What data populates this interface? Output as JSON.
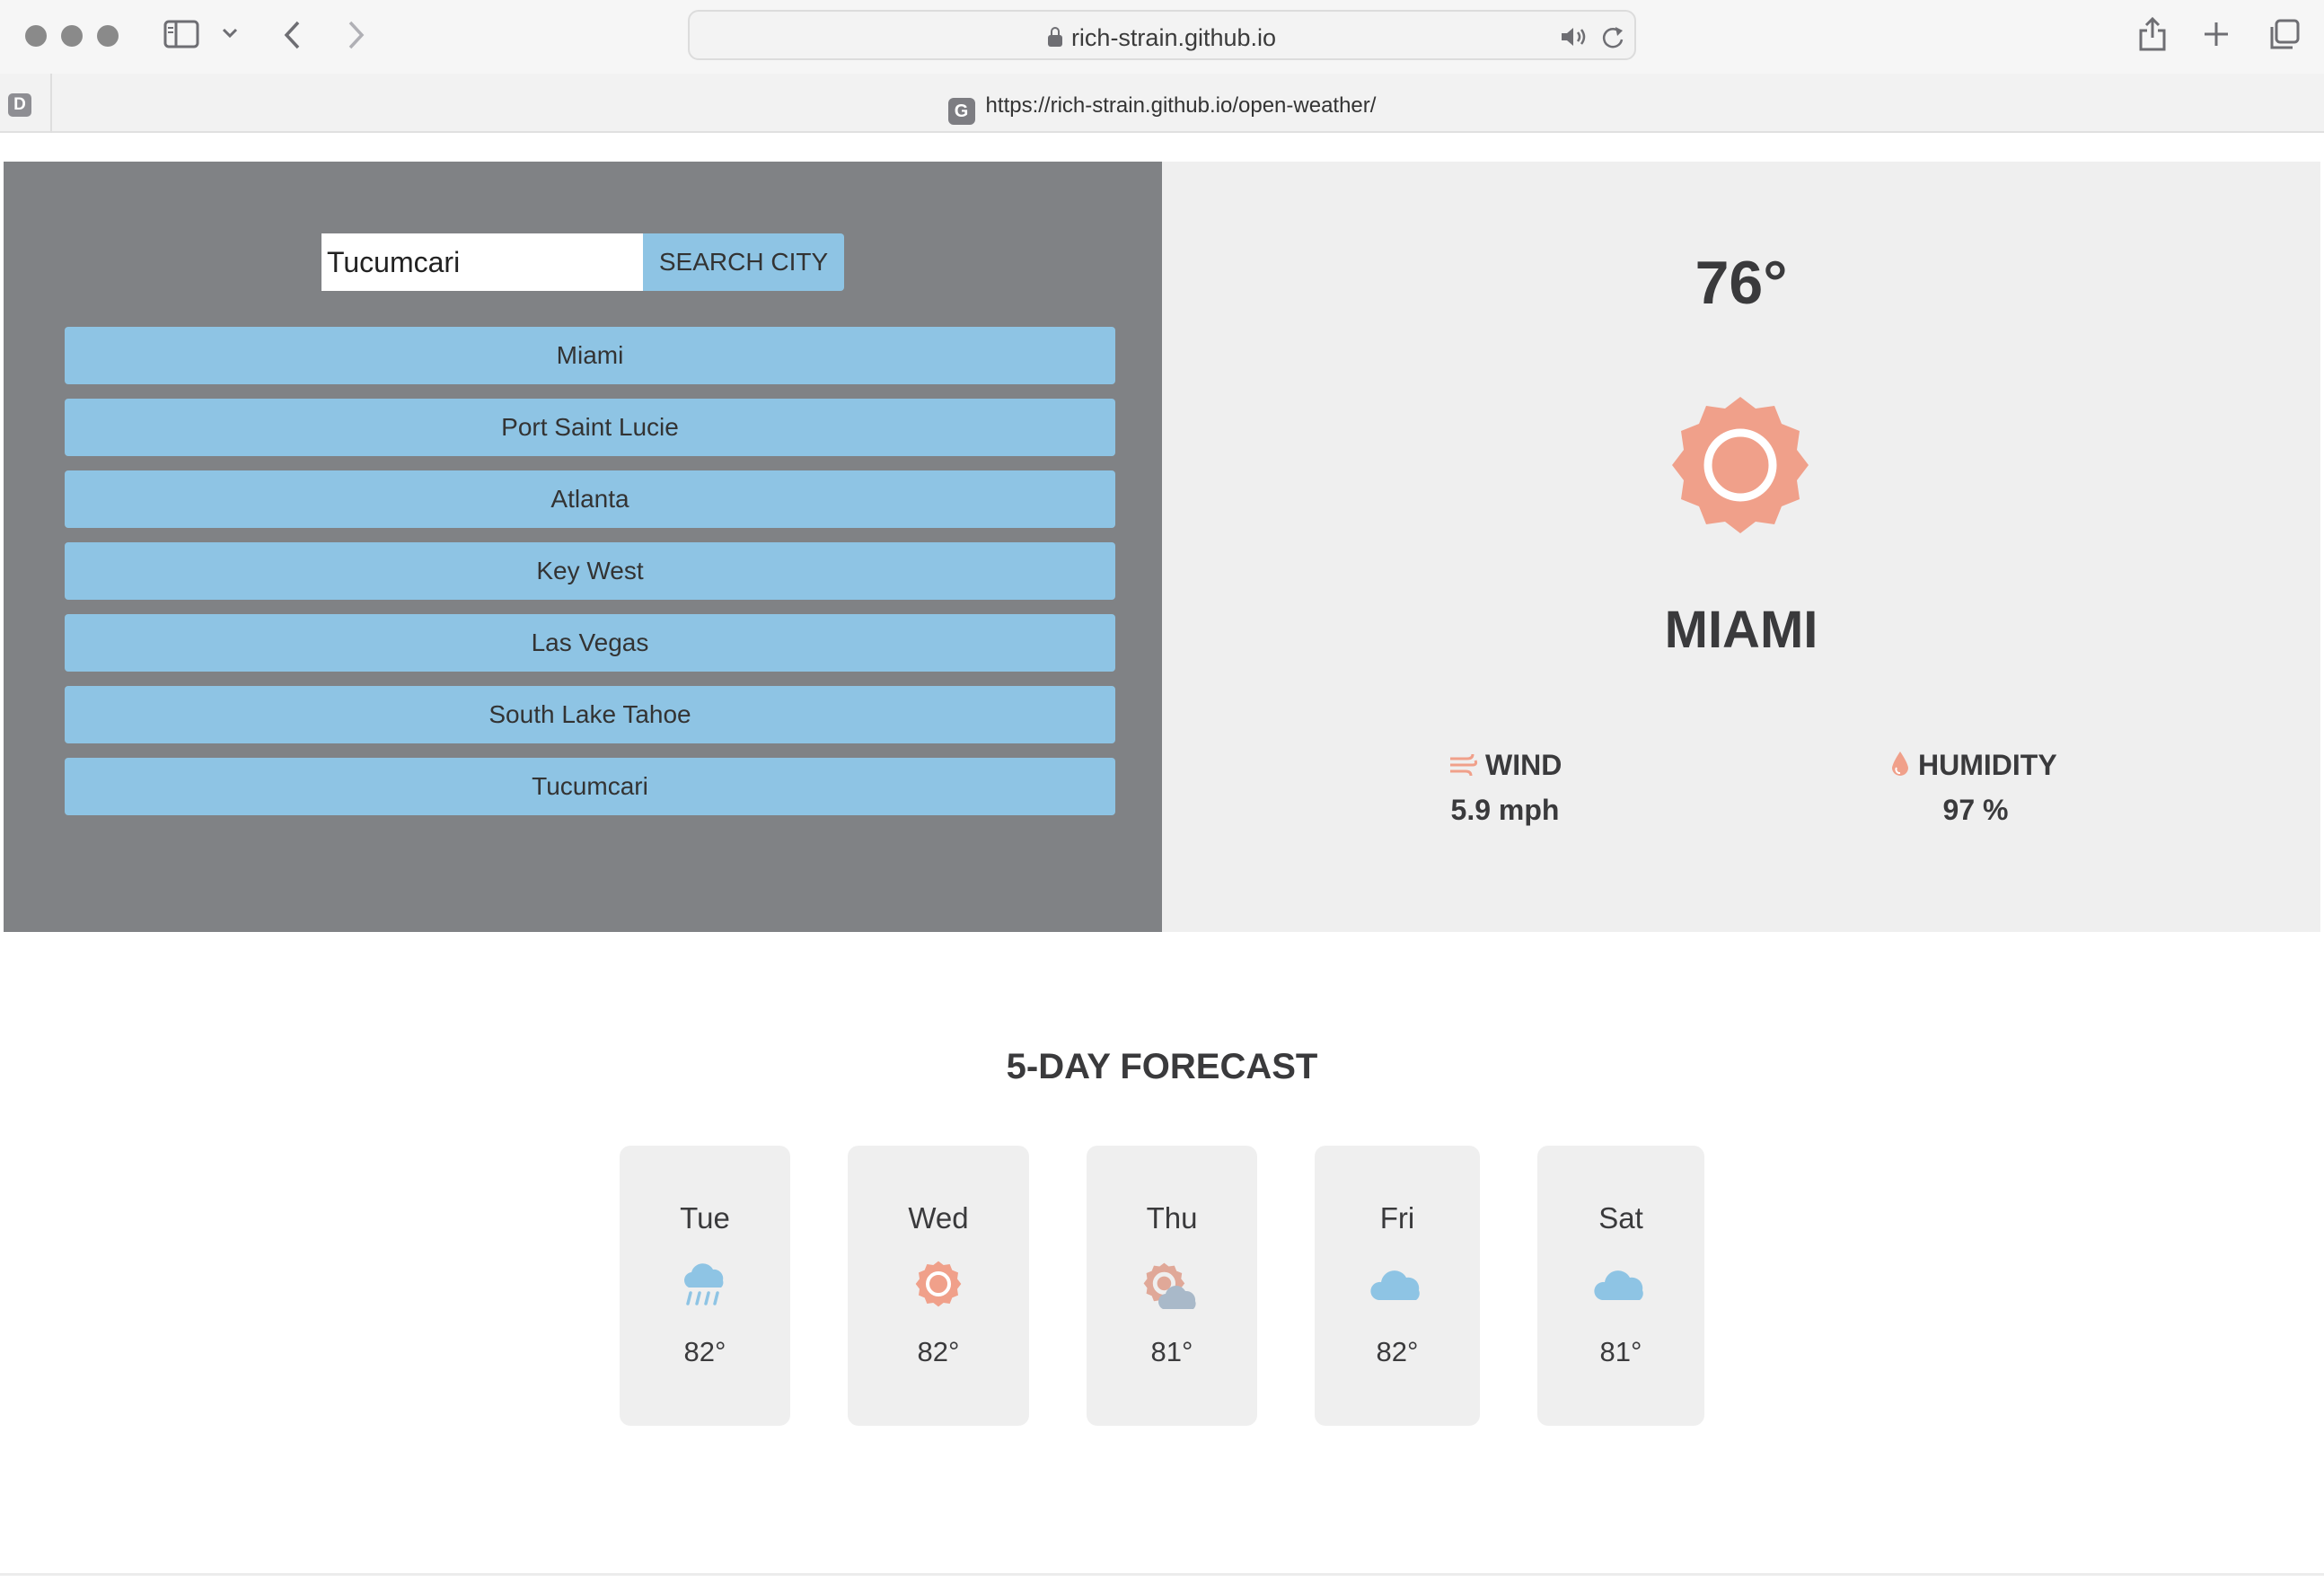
{
  "browser": {
    "address": "rich-strain.github.io",
    "tab_badge": "D",
    "tab_favicon": "G",
    "tab_title": "https://rich-strain.github.io/open-weather/"
  },
  "search": {
    "input_value": "Tucumcari",
    "button_label": "SEARCH CITY"
  },
  "history": [
    "Miami",
    "Port Saint Lucie",
    "Atlanta",
    "Key West",
    "Las Vegas",
    "South Lake Tahoe",
    "Tucumcari"
  ],
  "current": {
    "temperature": "76°",
    "icon": "sun-icon",
    "city": "MIAMI",
    "wind_label": "WIND",
    "wind_value": "5.9 mph",
    "humidity_label": "HUMIDITY",
    "humidity_value": "97 %"
  },
  "forecast": {
    "title": "5-DAY FORECAST",
    "days": [
      {
        "day": "Tue",
        "icon": "rain-cloud-icon",
        "temp": "82°"
      },
      {
        "day": "Wed",
        "icon": "sun-icon",
        "temp": "82°"
      },
      {
        "day": "Thu",
        "icon": "partly-cloudy-icon",
        "temp": "81°"
      },
      {
        "day": "Fri",
        "icon": "cloud-icon",
        "temp": "82°"
      },
      {
        "day": "Sat",
        "icon": "cloud-icon",
        "temp": "81°"
      }
    ]
  },
  "colors": {
    "accent_blue": "#8ec4e4",
    "sun_coral": "#f0a08a",
    "panel_gray": "#808285",
    "panel_light": "#efefef"
  }
}
